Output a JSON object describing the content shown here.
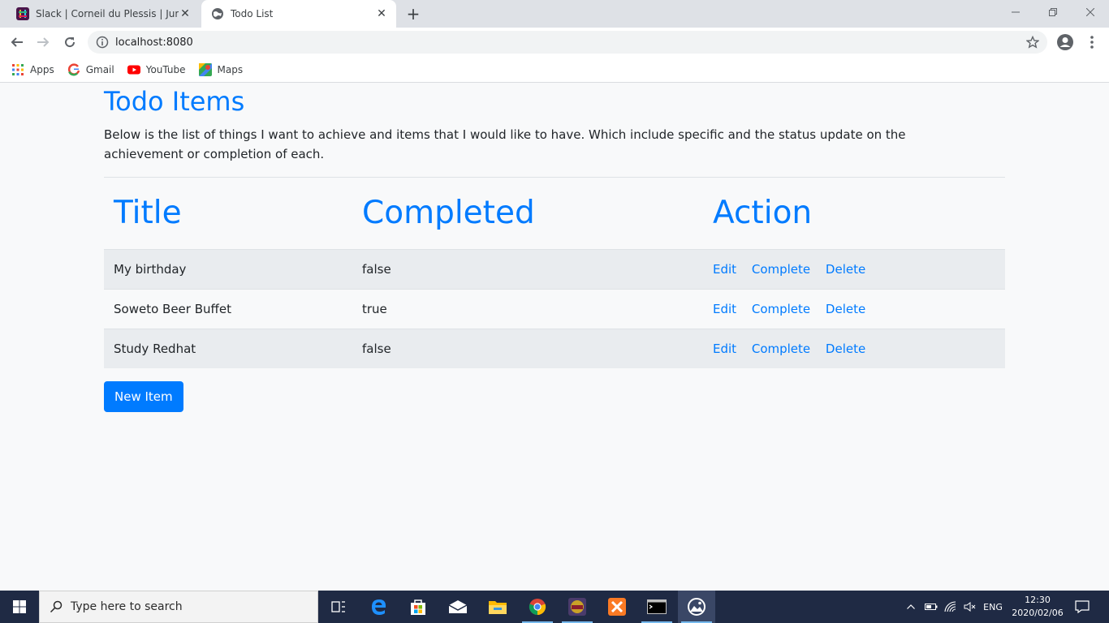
{
  "browser": {
    "tabs": [
      {
        "title": "Slack | Corneil du Plessis | JumpC",
        "favicon": "slack-icon",
        "active": false
      },
      {
        "title": "Todo List",
        "favicon": "globe-icon",
        "active": true
      }
    ],
    "url": "localhost:8080",
    "bookmarks": [
      {
        "label": "Apps",
        "icon": "apps-grid-icon"
      },
      {
        "label": "Gmail",
        "icon": "google-icon"
      },
      {
        "label": "YouTube",
        "icon": "youtube-icon"
      },
      {
        "label": "Maps",
        "icon": "maps-icon"
      }
    ]
  },
  "page": {
    "title": "Todo Items",
    "description": "Below is the list of things I want to achieve and items that I would like to have. Which include specific and the status update on the achievement or completion of each.",
    "table": {
      "headers": [
        "Title",
        "Completed",
        "Action"
      ],
      "rows": [
        {
          "title": "My birthday",
          "completed": "false",
          "actions": [
            "Edit",
            "Complete",
            "Delete"
          ]
        },
        {
          "title": "Soweto Beer Buffet",
          "completed": "true",
          "actions": [
            "Edit",
            "Complete",
            "Delete"
          ]
        },
        {
          "title": "Study Redhat",
          "completed": "false",
          "actions": [
            "Edit",
            "Complete",
            "Delete"
          ]
        }
      ]
    },
    "new_item_label": "New Item",
    "colors": {
      "primary": "#007bff",
      "stripe": "#e9ecef",
      "background": "#f8f9fa"
    }
  },
  "taskbar": {
    "search_placeholder": "Type here to search",
    "apps": [
      "task-view-icon",
      "edge-icon",
      "store-icon",
      "mail-icon",
      "file-explorer-icon",
      "chrome-icon",
      "app-icon",
      "xampp-icon",
      "terminal-icon",
      "photos-icon"
    ],
    "language": "ENG",
    "time": "12:30",
    "date": "2020/02/06"
  }
}
